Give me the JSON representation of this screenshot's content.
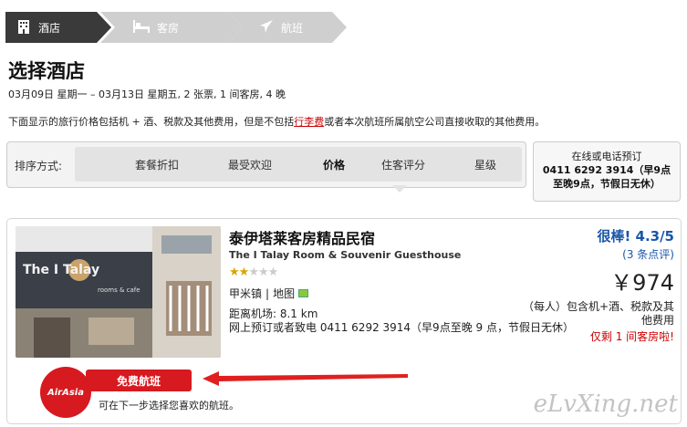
{
  "steps": [
    {
      "label": "酒店",
      "icon": "hotel-icon",
      "active": true
    },
    {
      "label": "客房",
      "icon": "bed-icon",
      "active": false
    },
    {
      "label": "航班",
      "icon": "plane-icon",
      "active": false
    }
  ],
  "title": "选择酒店",
  "trip_summary": "03月09日 星期一 – 03月13日 星期五, 2 张票, 1 间客房, 4 晚",
  "notice": {
    "before": "下面显示的旅行价格包括机 + 酒、税款及其他费用，但是不包括",
    "link": "行李费",
    "after": "或者本次航班所属航空公司直接收取的其他费用。"
  },
  "sort": {
    "label": "排序方式:",
    "options": [
      "套餐折扣",
      "最受欢迎",
      "价格",
      "住客评分",
      "星级"
    ],
    "active": "价格"
  },
  "phone_box": {
    "line1": "在线或电话预订",
    "line2": "0411 6292 3914（早9点",
    "line3": "至晚9点，节假日无休）"
  },
  "hotel": {
    "name_cn": "泰伊塔莱客房精品民宿",
    "name_en": "The I Talay Room & Souvenir Guesthouse",
    "stars": 2,
    "stars_max": 5,
    "location": "甲米镇",
    "map_link": "地图",
    "distance": "距离机场:  8.1 km",
    "booking": "网上预订或者致电 0411 6292 3914（早9点至晚 9 点，节假日无休）",
    "rating": "很棒! 4.3/5",
    "reviews": "(3 条点评)",
    "price": "￥974",
    "price_note": "（每人）包含机+酒、税款及其他费用",
    "rooms_left": "仅剩 1 间客房啦!",
    "photo_sign": "The I Talay",
    "photo_sign2": "rooms & cafe"
  },
  "promo": {
    "airline": "AirAsia",
    "button": "免费航班",
    "choose": "可在下一步选择您喜欢的航班。"
  },
  "watermark": "eLvXing.net",
  "colors": {
    "active_step": "#3a3a3a",
    "inactive_step": "#cfcfcf",
    "accent_red": "#d71920",
    "rating_blue": "#1a56a8"
  }
}
